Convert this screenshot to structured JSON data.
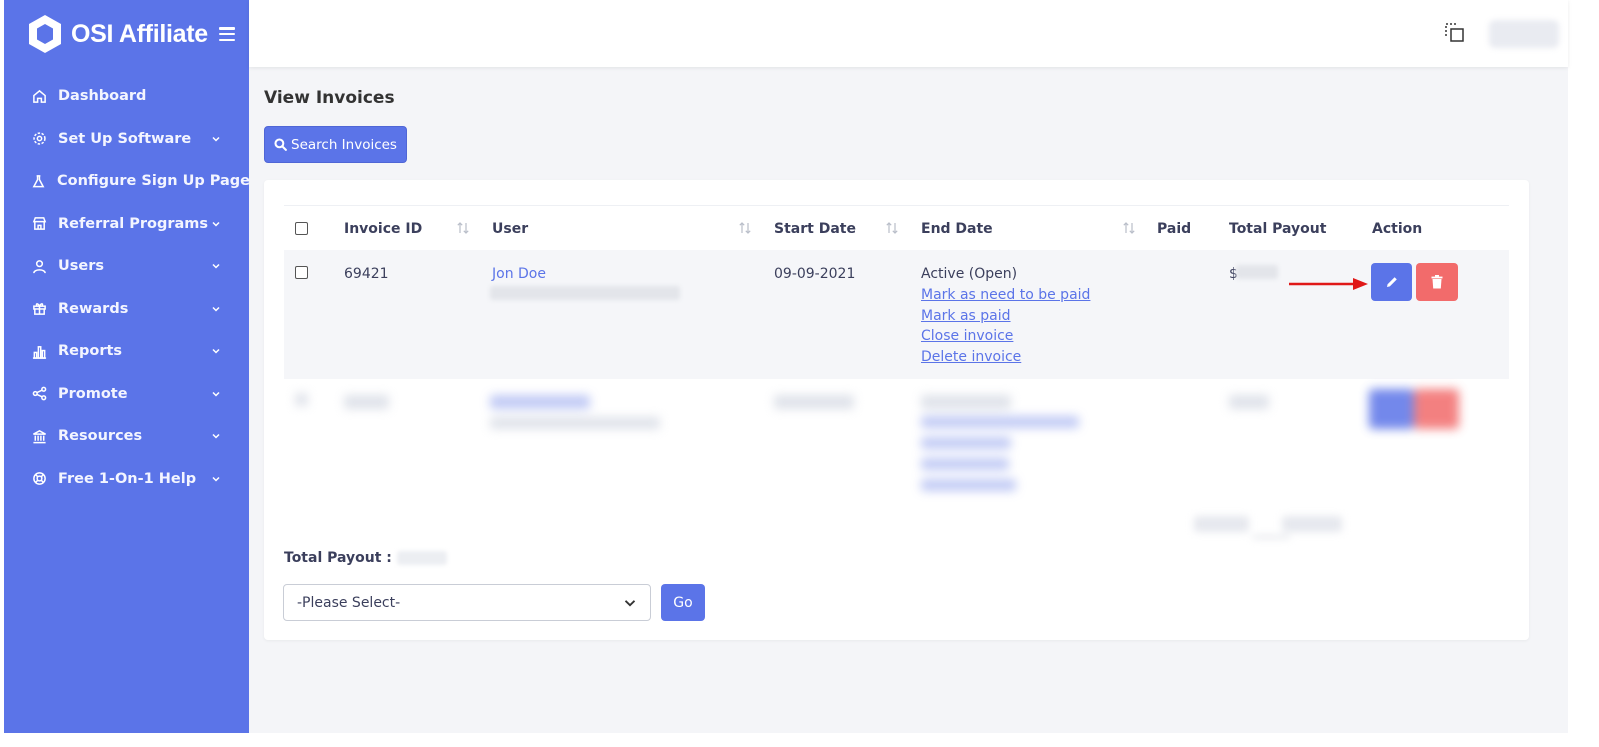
{
  "brand": {
    "name": "OSI Affiliate"
  },
  "sidebar": {
    "items": [
      {
        "label": "Dashboard",
        "icon": "home-icon",
        "has_submenu": false
      },
      {
        "label": "Set Up Software",
        "icon": "gear-icon",
        "has_submenu": true
      },
      {
        "label": "Configure Sign Up Page",
        "icon": "flask-icon",
        "has_submenu": false
      },
      {
        "label": "Referral Programs",
        "icon": "store-icon",
        "has_submenu": true
      },
      {
        "label": "Users",
        "icon": "user-icon",
        "has_submenu": true
      },
      {
        "label": "Rewards",
        "icon": "gift-icon",
        "has_submenu": true
      },
      {
        "label": "Reports",
        "icon": "bar-chart-icon",
        "has_submenu": true
      },
      {
        "label": "Promote",
        "icon": "share-icon",
        "has_submenu": true
      },
      {
        "label": "Resources",
        "icon": "bank-icon",
        "has_submenu": true
      },
      {
        "label": "Free 1-On-1 Help",
        "icon": "lifebuoy-icon",
        "has_submenu": true
      }
    ]
  },
  "header": {
    "fullscreen_icon": "fullscreen-icon"
  },
  "page": {
    "title": "View Invoices",
    "search_button": "Search Invoices"
  },
  "table": {
    "columns": [
      "Invoice ID",
      "User",
      "Start Date",
      "End Date",
      "Paid",
      "Total Payout",
      "Action"
    ],
    "rows": [
      {
        "invoice_id": "69421",
        "user": "Jon Doe",
        "start_date": "09-09-2021",
        "end_date_status": "Active (Open)",
        "links": [
          "Mark as need to be paid",
          "Mark as paid",
          "Close invoice",
          "Delete invoice"
        ],
        "paid": "",
        "total_payout": "$"
      }
    ]
  },
  "footer": {
    "total_payout_label": "Total Payout :",
    "bulk_select": "-Please Select-",
    "go_button": "Go"
  },
  "colors": {
    "sidebar": "#5b74e8",
    "primary": "#5b74e8",
    "danger": "#f26b6b",
    "annotation_arrow": "#e01818"
  }
}
